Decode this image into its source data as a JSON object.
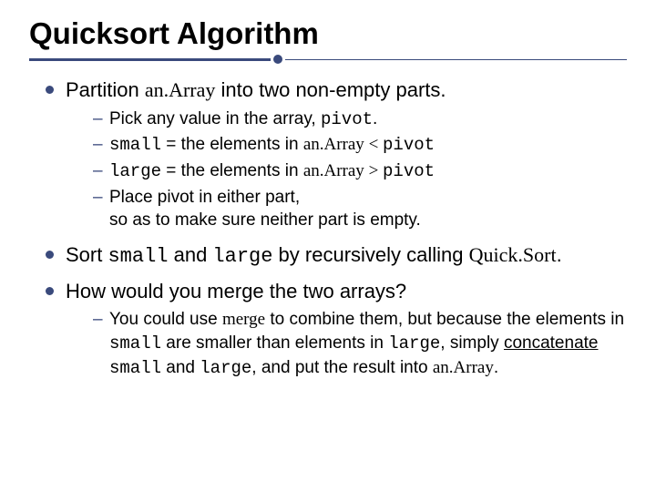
{
  "title": "Quicksort Algorithm",
  "b1": {
    "pre": "Partition ",
    "code": "an.Array",
    "post": " into two non-empty parts.",
    "s1": {
      "pre": "Pick any value in the array, ",
      "code": "pivot",
      "post": "."
    },
    "s2": {
      "c1": "small",
      "t1": " = the elements in ",
      "c2": "an.Array",
      "op": " < ",
      "c3": "pivot"
    },
    "s3": {
      "c1": "large",
      "t1": " = the elements in ",
      "c2": "an.Array",
      "op": " > ",
      "c3": "pivot"
    },
    "s4": {
      "l1": "Place pivot in either part,",
      "l2": "so as to make sure neither part is empty."
    }
  },
  "b2": {
    "pre": "Sort ",
    "c1": "small",
    "mid": " and ",
    "c2": "large",
    "post1": " by recursively calling ",
    "serif": "Quick.Sort",
    "post2": "."
  },
  "b3": {
    "q": "How would you merge the two arrays?",
    "ans": {
      "t1": "You could use ",
      "c1": "merge",
      "t2": " to combine them, but because the elements in ",
      "c2": "small",
      "t3": " are smaller than elements in ",
      "c3": "large",
      "t4": ", simply ",
      "u": "concatenate",
      "t5": " ",
      "c4": "small",
      "t6": " and ",
      "c5": "large",
      "t7": ", and put the result into ",
      "c6": "an.Array",
      "t8": "."
    }
  }
}
